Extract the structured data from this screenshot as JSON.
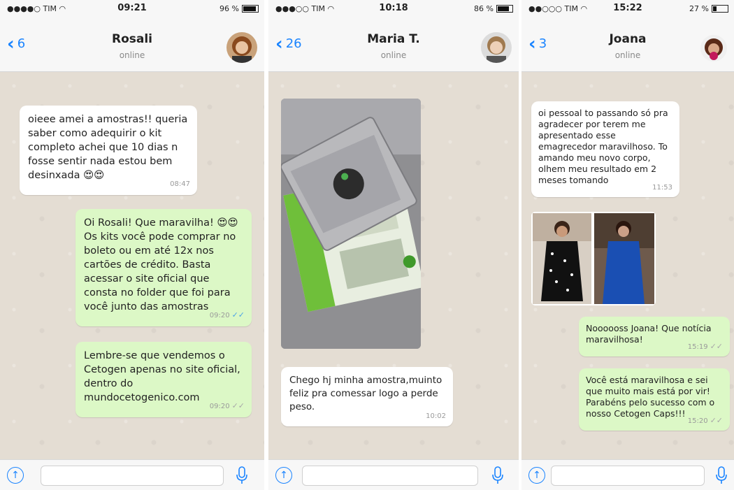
{
  "panels": [
    {
      "status": {
        "carrier": "●●●●○ TIM",
        "time": "09:21",
        "battery": "96 %",
        "battery_level": 0.96
      },
      "header": {
        "back_count": "6",
        "contact": "Rosali",
        "status": "online"
      },
      "messages": [
        {
          "dir": "in",
          "text": "oieee amei a amostras!! queria saber como adequirir o kit completo achei que 10 dias n fosse sentir nada estou bem desinxada 😍😍",
          "time": "08:47"
        },
        {
          "dir": "out",
          "text": "Oi Rosali! Que maravilha! 😍😍 Os kits você pode comprar no boleto ou em até 12x nos cartões de crédito. Basta acessar o site oficial que consta no folder que foi para você junto das amostras",
          "time": "09:20",
          "ticks": "✓✓",
          "read": true
        },
        {
          "dir": "out",
          "text": "Lembre-se que vendemos o Cetogen apenas no site oficial, dentro do mundocetogenico.com",
          "time": "09:20",
          "ticks": "✓✓",
          "read": false
        }
      ]
    },
    {
      "status": {
        "carrier": "●●●○○ TIM",
        "time": "10:18",
        "battery": "86 %",
        "battery_level": 0.86
      },
      "header": {
        "back_count": "26",
        "contact": "Maria T.",
        "status": "online"
      },
      "messages": [
        {
          "dir": "in",
          "type": "photo",
          "desc": "Cetogen Caps sample and folder"
        },
        {
          "dir": "in",
          "text": "Chego hj minha amostra,muinto feliz pra comessar logo a perde peso.",
          "time": "10:02"
        }
      ]
    },
    {
      "status": {
        "carrier": "●●○○○ TIM",
        "time": "15:22",
        "battery": "27 %",
        "battery_level": 0.27
      },
      "header": {
        "back_count": "3",
        "contact": "Joana",
        "status": "online"
      },
      "messages": [
        {
          "dir": "in",
          "text": "oi pessoal to passando só pra agradecer por terem me apresentado esse emagrecedor maravilhoso. To amando meu novo corpo, olhem meu resultado em 2 meses tomando",
          "time": "11:53"
        },
        {
          "dir": "in",
          "type": "photo",
          "desc": "before and after photos"
        },
        {
          "dir": "out",
          "text": "Noooooss Joana! Que notícia maravilhosa!",
          "time": "15:19",
          "ticks": "✓✓",
          "read": false
        },
        {
          "dir": "out",
          "text": "Você está maravilhosa e sei que muito mais está por vir! Parabéns pelo sucesso com o nosso Cetogen Caps!!!",
          "time": "15:20",
          "ticks": "✓✓",
          "read": false
        }
      ]
    }
  ],
  "colors": {
    "accent": "#1a84ff",
    "outgoing": "#dcf8c6",
    "incoming": "#ffffff",
    "chat_bg": "#e4ddd3",
    "read_ticks": "#4aa3e8"
  },
  "icons": {
    "back": "chevron-left-icon",
    "upload": "upload-icon",
    "mic": "microphone-icon",
    "wifi": "wifi-icon",
    "battery": "battery-icon"
  }
}
